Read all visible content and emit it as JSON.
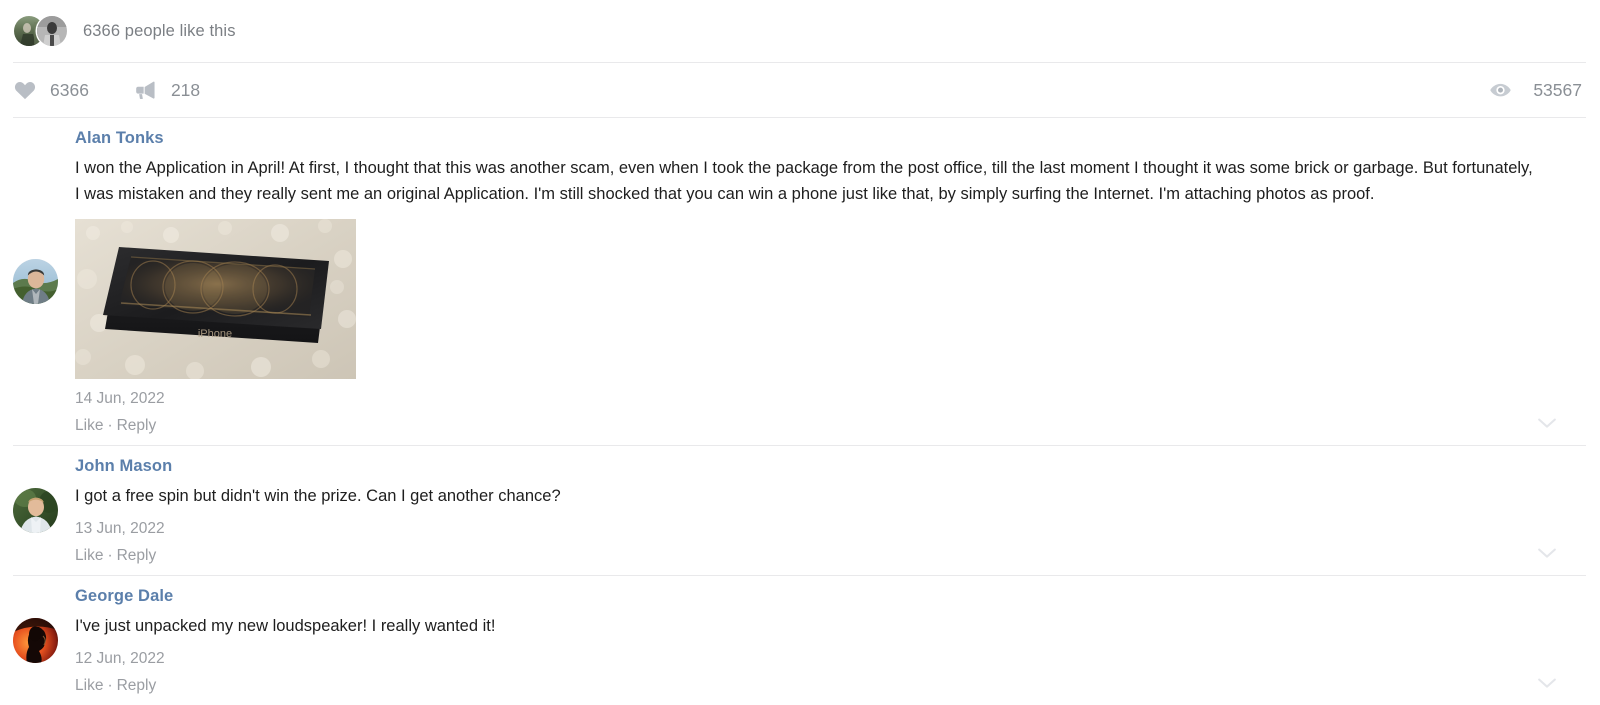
{
  "likes_summary": {
    "text": "6366 people like this",
    "avatar_count": 2,
    "avatars": [
      {
        "name": "liker-avatar-1",
        "alt": "person in green outdoor photo"
      },
      {
        "name": "liker-avatar-2",
        "alt": "black and white portrait"
      }
    ]
  },
  "counters": {
    "likes": {
      "icon": "heart-icon",
      "value": "6366"
    },
    "shares": {
      "icon": "megaphone-icon",
      "value": "218"
    },
    "views": {
      "icon": "eye-icon",
      "value": "53567"
    }
  },
  "icon_color": "#b9bec5",
  "author_color": "#5b7fab",
  "meta_color": "#9a9da2",
  "comments": [
    {
      "author": "Alan Tonks",
      "text": "I won the Application in April! At first, I thought that this was another scam, even when I took the package from the post office, till the last moment I thought it was some brick or garbage. But fortunately, I was mistaken and they really sent me an original Application. I'm still shocked that you can win a phone just like that, by simply surfing the Internet. I'm attaching photos as proof.",
      "date": "14 Jun, 2022",
      "like_label": "Like",
      "separator": "·",
      "reply_label": "Reply",
      "has_photo": true,
      "photo_alt": "iPhone box on white shag carpet",
      "photo_caption": "iPhone",
      "avatar_alt": "man outdoors with hills behind",
      "chevron": "chevron-down-icon"
    },
    {
      "author": "John Mason",
      "text": "I got a free spin but didn't win the prize. Can I get another chance?",
      "date": "13 Jun, 2022",
      "like_label": "Like",
      "separator": "·",
      "reply_label": "Reply",
      "has_photo": false,
      "avatar_alt": "man in light shirt with dark green foliage",
      "chevron": "chevron-down-icon"
    },
    {
      "author": "George Dale",
      "text": "I've just unpacked my new loudspeaker! I really wanted it!",
      "date": "12 Jun, 2022",
      "like_label": "Like",
      "separator": "·",
      "reply_label": "Reply",
      "has_photo": false,
      "avatar_alt": "dark silhouette on orange red background",
      "chevron": "chevron-down-icon"
    }
  ]
}
